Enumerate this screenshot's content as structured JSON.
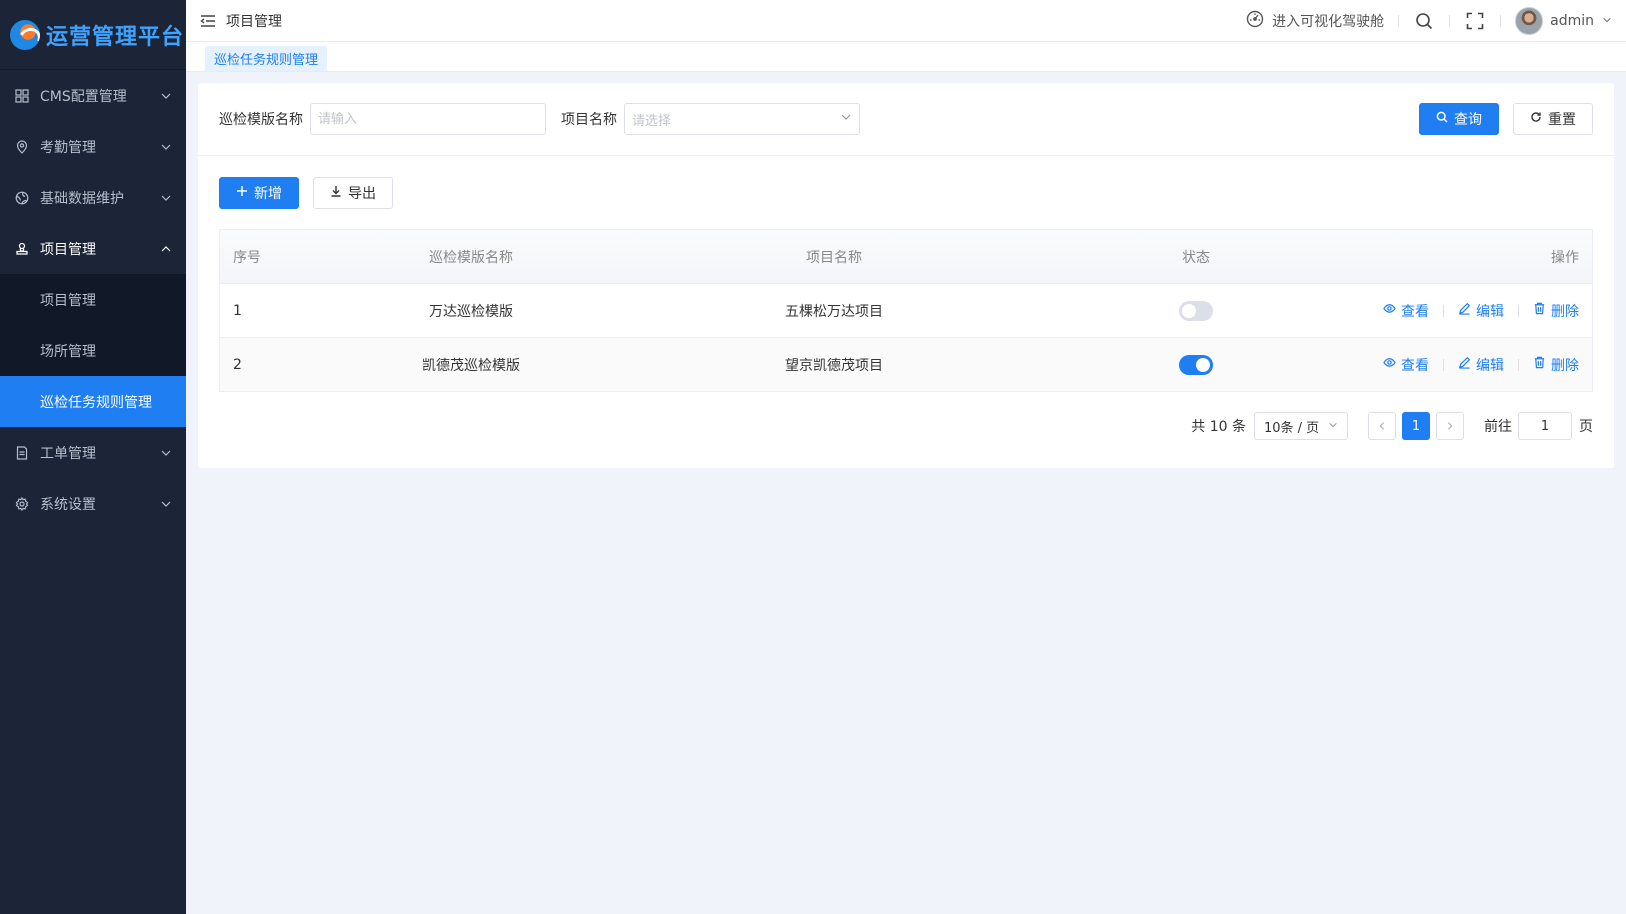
{
  "sidebar": {
    "logo_text": "运营管理平台",
    "items": [
      {
        "label": "CMS配置管理",
        "icon": "grid-icon"
      },
      {
        "label": "考勤管理",
        "icon": "location-pin-icon"
      },
      {
        "label": "基础数据维护",
        "icon": "globe-icon"
      },
      {
        "label": "项目管理",
        "icon": "user-stamp-icon"
      },
      {
        "label": "工单管理",
        "icon": "document-icon"
      },
      {
        "label": "系统设置",
        "icon": "gear-icon"
      }
    ],
    "submenu": [
      "项目管理",
      "场所管理",
      "巡检任务规则管理"
    ]
  },
  "header": {
    "title": "项目管理",
    "cockpit_link": "进入可视化驾驶舱",
    "user": "admin"
  },
  "tabs": [
    "巡检任务规则管理"
  ],
  "filters": {
    "template_label": "巡检模版名称",
    "template_placeholder": "请输入",
    "project_label": "项目名称",
    "project_placeholder": "请选择",
    "query_button": "查询",
    "reset_button": "重置"
  },
  "toolbar": {
    "add_button": "新增",
    "export_button": "导出"
  },
  "table": {
    "columns": [
      "序号",
      "巡检模版名称",
      "项目名称",
      "状态",
      "操作"
    ],
    "rows": [
      {
        "index": "1",
        "template": "万达巡检模版",
        "project": "五棵松万达项目",
        "status_on": false
      },
      {
        "index": "2",
        "template": "凯德茂巡检模版",
        "project": "望京凯德茂项目",
        "status_on": true
      }
    ],
    "actions": {
      "view": "查看",
      "edit": "编辑",
      "delete": "删除"
    }
  },
  "pagination": {
    "total": "共 10 条",
    "page_size": "10条 / 页",
    "current_page": "1",
    "goto_label": "前往",
    "goto_value": "1",
    "page_suffix": "页"
  },
  "colors": {
    "primary": "#1e7ef2",
    "sidebar_bg": "#1b2537",
    "submenu_bg": "#111827"
  }
}
